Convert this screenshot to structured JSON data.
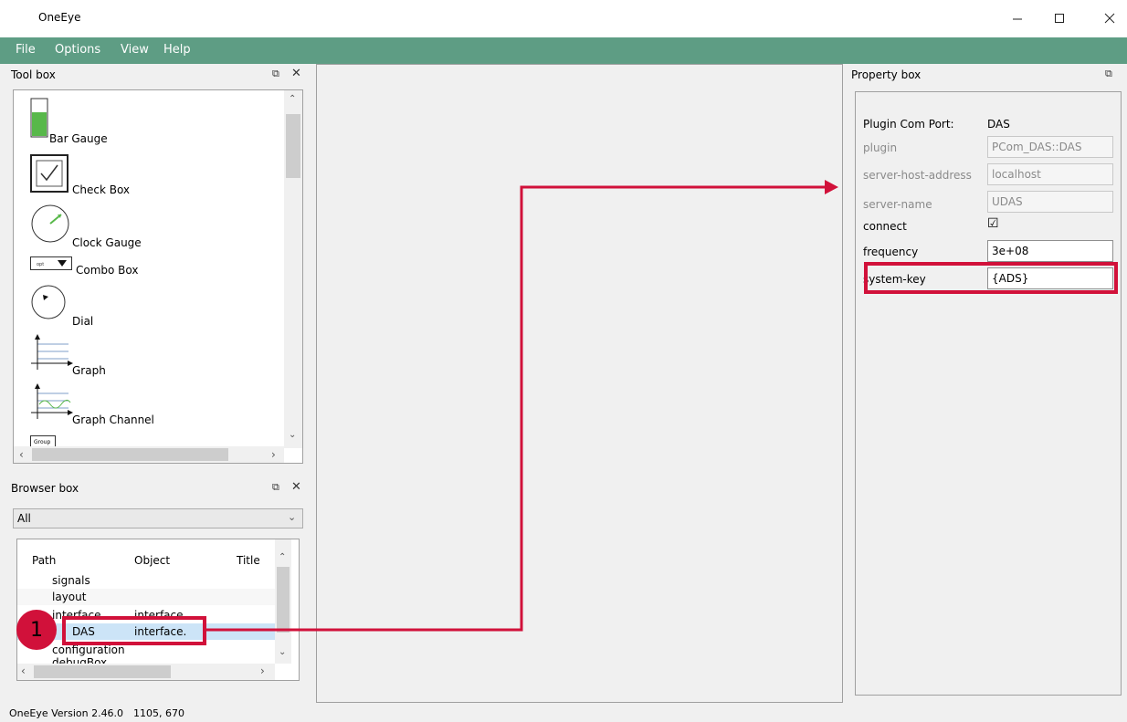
{
  "window": {
    "title": "OneEye"
  },
  "menu": [
    "File",
    "Options",
    "View",
    "Help"
  ],
  "toolbox": {
    "title": "Tool box",
    "items": [
      "Bar Gauge",
      "Check Box",
      "Clock Gauge",
      "Combo Box",
      "Dial",
      "Graph",
      "Graph Channel"
    ],
    "partial_item_text": "Group"
  },
  "browserbox": {
    "title": "Browser box",
    "filter": "All",
    "columns": [
      "Path",
      "Object",
      "Title"
    ],
    "rows": [
      {
        "path": "signals",
        "object": ""
      },
      {
        "path": "layout",
        "object": ""
      },
      {
        "path": "interface",
        "object": "interface"
      },
      {
        "path": "DAS",
        "object": "interface."
      },
      {
        "path": "configuration",
        "object": ""
      },
      {
        "path": "debugBox",
        "object": ""
      }
    ],
    "selected_row": "DAS"
  },
  "propertybox": {
    "title": "Property box",
    "header_label": "Plugin Com Port:",
    "header_value": "DAS",
    "props": [
      {
        "label": "plugin",
        "value": "PCom_DAS::DAS"
      },
      {
        "label": "server-host-address",
        "value": "localhost"
      },
      {
        "label": "server-name",
        "value": "UDAS"
      },
      {
        "label": "connect",
        "value": "☑"
      },
      {
        "label": "frequency",
        "value": "3e+08"
      },
      {
        "label": "system-key",
        "value": "{ADS}"
      }
    ]
  },
  "callout": {
    "number": "1"
  },
  "status": {
    "version": "OneEye Version 2.46.0",
    "coords": "1105, 670"
  },
  "colors": {
    "menubar": "#5e9d84",
    "highlight": "#d1113a",
    "selection": "#cce4f7"
  }
}
